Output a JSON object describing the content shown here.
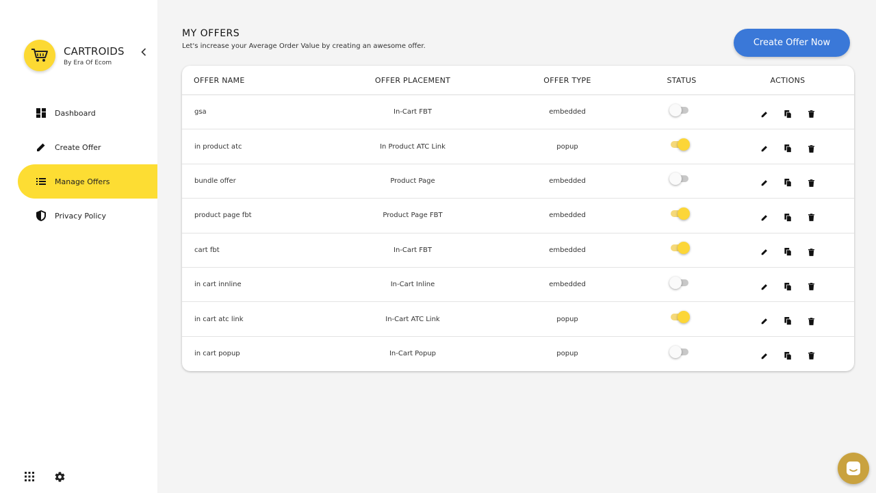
{
  "brand": {
    "name": "CARTROIDS",
    "subtitle": "By Era Of Ecom"
  },
  "nav": {
    "items": [
      {
        "label": "Dashboard",
        "icon": "dashboard-icon",
        "active": false
      },
      {
        "label": "Create Offer",
        "icon": "pencil-icon",
        "active": false
      },
      {
        "label": "Manage Offers",
        "icon": "list-icon",
        "active": true
      },
      {
        "label": "Privacy Policy",
        "icon": "shield-icon",
        "active": false
      }
    ]
  },
  "header": {
    "title": "MY OFFERS",
    "subtitle": "Let's increase your Average Order Value by creating an awesome offer.",
    "create_button": "Create Offer Now"
  },
  "table": {
    "columns": [
      "OFFER NAME",
      "OFFER PLACEMENT",
      "OFFER TYPE",
      "STATUS",
      "ACTIONS"
    ],
    "rows": [
      {
        "name": "gsa",
        "placement": "In-Cart FBT",
        "type": "embedded",
        "status": false
      },
      {
        "name": "in product atc",
        "placement": "In Product ATC Link",
        "type": "popup",
        "status": true
      },
      {
        "name": "bundle offer",
        "placement": "Product Page",
        "type": "embedded",
        "status": false
      },
      {
        "name": "product page fbt",
        "placement": "Product Page FBT",
        "type": "embedded",
        "status": true
      },
      {
        "name": "cart fbt",
        "placement": "In-Cart FBT",
        "type": "embedded",
        "status": true
      },
      {
        "name": "in cart innline",
        "placement": "In-Cart Inline",
        "type": "embedded",
        "status": false
      },
      {
        "name": "in cart atc link",
        "placement": "In-Cart ATC Link",
        "type": "popup",
        "status": true
      },
      {
        "name": "in cart popup",
        "placement": "In-Cart Popup",
        "type": "popup",
        "status": false
      }
    ]
  },
  "colors": {
    "accent": "#fddd33",
    "primary": "#3a78d8",
    "chat": "#c9a23f"
  }
}
